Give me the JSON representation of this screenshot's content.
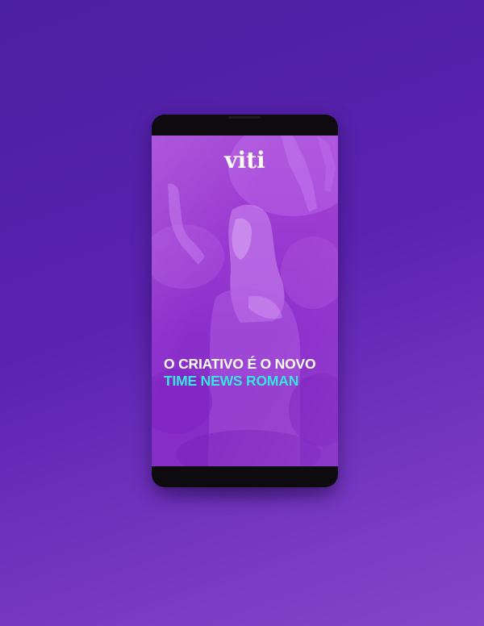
{
  "app": {
    "logo_text": "viti"
  },
  "headline": {
    "line1": "O CRIATIVO É O NOVO",
    "line2": "TIME NEWS ROMAN"
  },
  "colors": {
    "background": "#5a22b0",
    "screen_tint": "#9a3ad2",
    "headline_white": "#ffffff",
    "headline_accent": "#37e6e0",
    "phone_body": "#0d0b10"
  }
}
